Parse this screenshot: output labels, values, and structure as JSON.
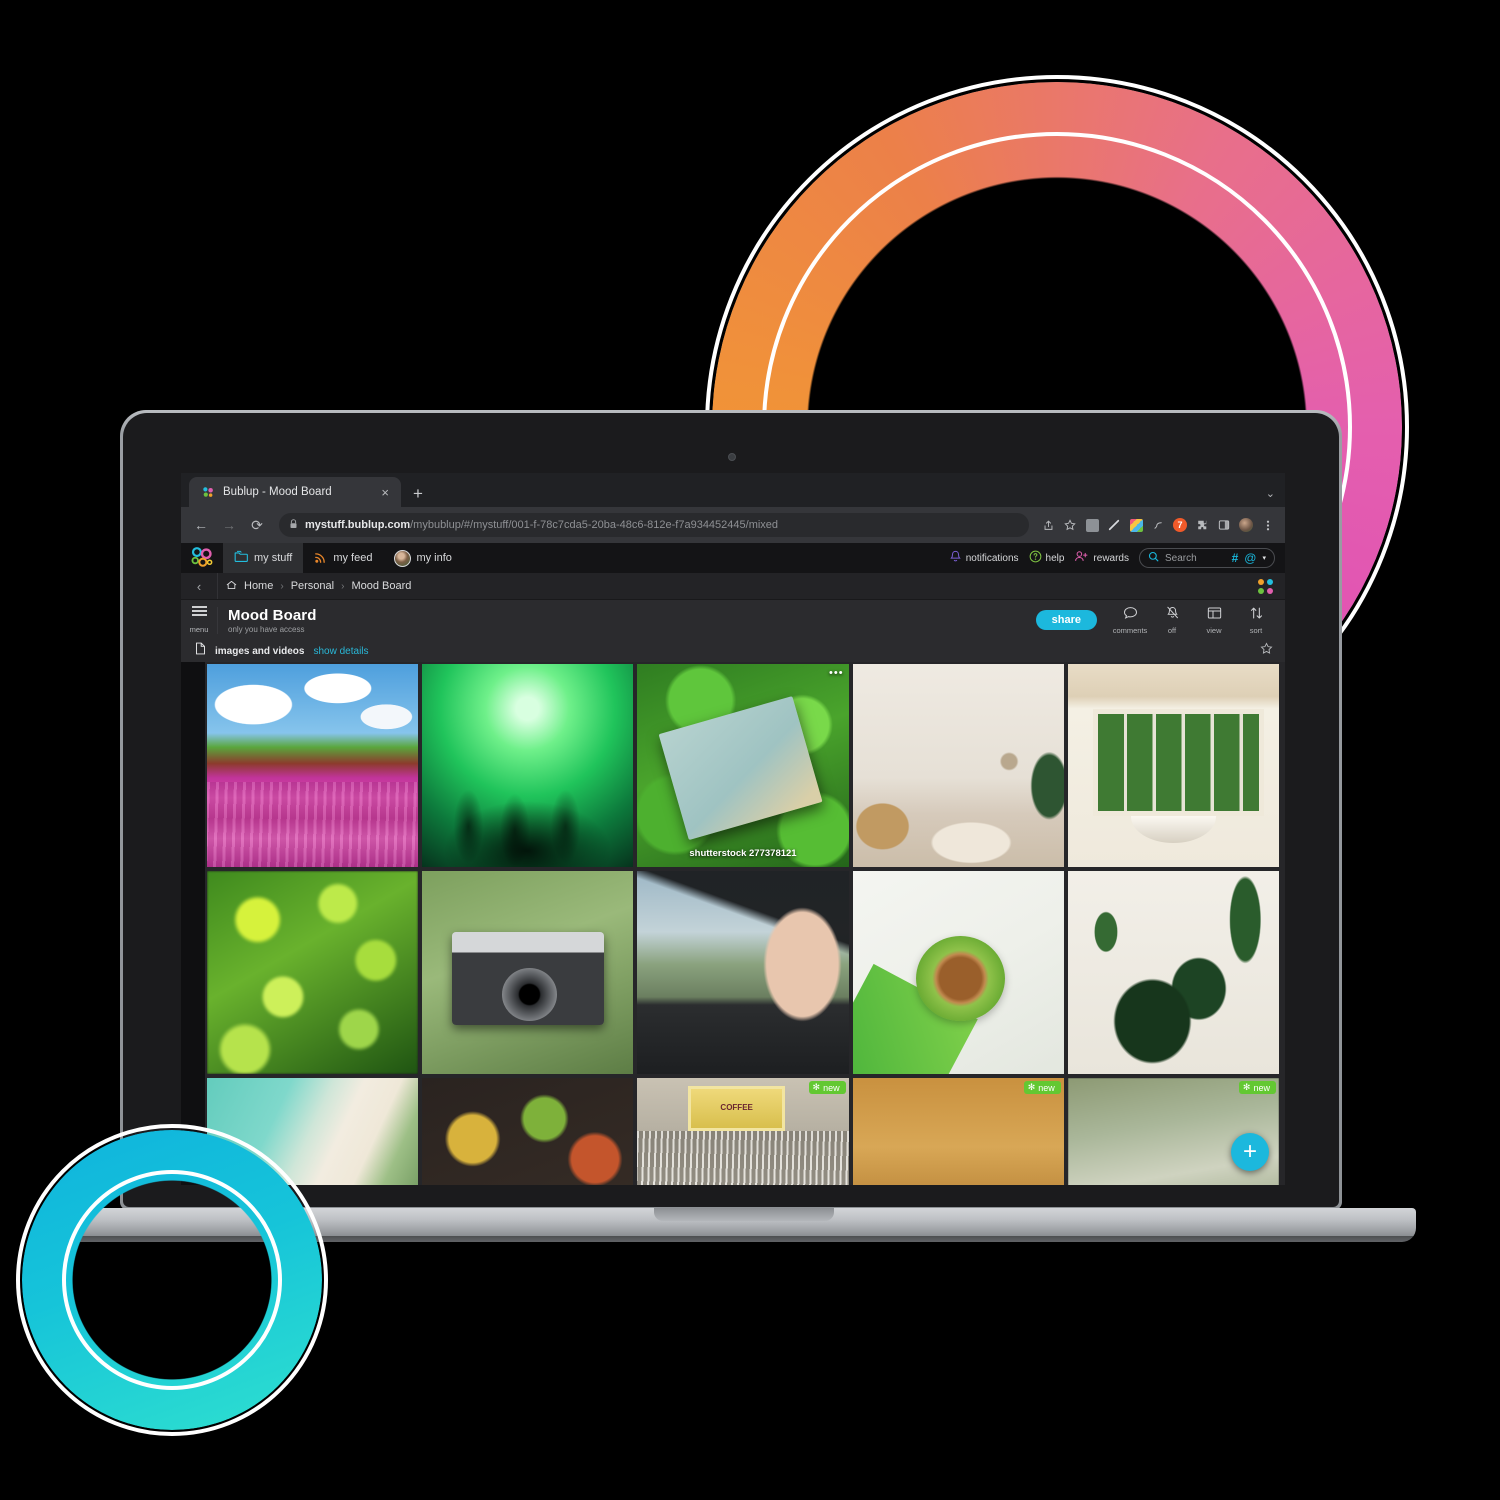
{
  "browser": {
    "tab": {
      "title": "Bublup - Mood Board",
      "favicon": "bublup-logo-icon",
      "close": "×"
    },
    "new_tab": "+",
    "tabstrip_caret": "⌄",
    "nav": {
      "back": "←",
      "forward": "→",
      "reload": "⟳"
    },
    "omnibox": {
      "lock_icon": "lock-icon",
      "url_host": "mystuff.bublup.com",
      "url_path": "/mybublup/#/mystuff/001-f-78c7cda5-20ba-48c6-812e-f7a934452445/mixed",
      "share_icon": "share-icon",
      "bookmark_icon": "star-icon"
    },
    "extensions": [
      "reader-extension-icon",
      "pen-extension-icon",
      "colorgrid-extension-icon",
      "feather-extension-icon",
      "orange-extension-icon",
      "puzzle-extension-icon",
      "sidepanel-icon",
      "profile-avatar",
      "kebab-menu-icon"
    ]
  },
  "app": {
    "logo": "bublup-logo",
    "tabs": [
      {
        "label": "my stuff",
        "icon": "folder-icon",
        "active": true
      },
      {
        "label": "my feed",
        "icon": "rss-icon",
        "active": false
      },
      {
        "label": "my info",
        "icon": "avatar-icon",
        "active": false
      }
    ],
    "header_right": {
      "notifications": {
        "label": "notifications",
        "icon": "bell-icon",
        "color": "#7b5fd4"
      },
      "help": {
        "label": "help",
        "icon": "question-circle-icon",
        "color": "#7ec242"
      },
      "rewards": {
        "label": "rewards",
        "icon": "user-plus-icon",
        "color": "#e05fae"
      },
      "search": {
        "placeholder": "Search",
        "icon": "search-icon",
        "hash_icon": "#",
        "at_icon": "@",
        "caret_icon": "▾",
        "accent": "#19b8dd"
      }
    },
    "breadcrumb": {
      "back_icon": "‹",
      "home_icon": "home-icon",
      "items": [
        "Home",
        "Personal",
        "Mood Board"
      ],
      "separator": "›",
      "dots_grid": {
        "colors": [
          "#f0a12c",
          "#23bede",
          "#6dc23f",
          "#e05fae"
        ]
      }
    },
    "folder": {
      "menu_label": "menu",
      "title": "Mood Board",
      "subtitle": "only you have access"
    },
    "toolbar": {
      "share_label": "share",
      "share_color": "#1cb8dd",
      "items": [
        {
          "label": "comments",
          "icon": "comment-bubble-icon"
        },
        {
          "label": "off",
          "icon": "bell-slash-icon"
        },
        {
          "label": "view",
          "icon": "layout-icon"
        },
        {
          "label": "sort",
          "icon": "sort-arrows-icon"
        }
      ]
    },
    "filterbar": {
      "icon": "file-icon",
      "label": "images and videos",
      "details_link": "show details",
      "details_color": "#29b8d8",
      "star_icon": "star-outline-icon"
    },
    "left_rail": {
      "trash_icon": "trash-icon"
    },
    "fab": {
      "icon": "plus-icon",
      "color": "#1cb8dd"
    },
    "badge_new": {
      "label": "new",
      "icon": "sparkle-icon",
      "color": "#63c832"
    },
    "grid": {
      "items": [
        {
          "name": "windmills-tulip-field",
          "art": "a-windmill",
          "caption": "",
          "badge": false,
          "dots": false
        },
        {
          "name": "green-party-crowd",
          "art": "a-party",
          "caption": "",
          "badge": false,
          "dots": false
        },
        {
          "name": "vintage-book-in-grass",
          "art": "a-book",
          "caption": "shutterstock 277378121",
          "badge": false,
          "dots": true
        },
        {
          "name": "boho-bedroom-interior",
          "art": "a-bedroom",
          "caption": "",
          "badge": false,
          "dots": false
        },
        {
          "name": "bathroom-with-window",
          "art": "a-bath",
          "caption": "",
          "badge": false,
          "dots": false
        },
        {
          "name": "green-bokeh-leaves",
          "art": "a-bokeh",
          "caption": "",
          "badge": false,
          "dots": false
        },
        {
          "name": "hand-holding-camera",
          "art": "a-camera",
          "caption": "",
          "badge": false,
          "dots": false
        },
        {
          "name": "feet-out-car-window",
          "art": "a-feet",
          "caption": "",
          "badge": false,
          "dots": false
        },
        {
          "name": "coffee-cup-desk-flatlay",
          "art": "a-coffee",
          "caption": "",
          "badge": false,
          "dots": false
        },
        {
          "name": "houseplants-on-wall",
          "art": "a-plant",
          "caption": "",
          "badge": false,
          "dots": false
        },
        {
          "name": "tropical-beach-aerial",
          "art": "a-beach",
          "caption": "",
          "badge": false,
          "dots": false
        },
        {
          "name": "bowls-of-food-flatlay",
          "art": "a-food",
          "caption": "",
          "badge": false,
          "dots": false
        },
        {
          "name": "drying-fish-market-sign",
          "art": "a-fish",
          "caption": "",
          "badge": true,
          "badge_side": "right",
          "dots": false,
          "sign_text": "COFFEE"
        },
        {
          "name": "woman-in-wheat-field",
          "art": "a-woman",
          "caption": "",
          "badge": true,
          "badge_side": "right",
          "dots": false
        },
        {
          "name": "misty-landscape-texture",
          "art": "a-mist",
          "caption": "",
          "badge": true,
          "badge_side": "right",
          "dots": false
        }
      ]
    }
  }
}
